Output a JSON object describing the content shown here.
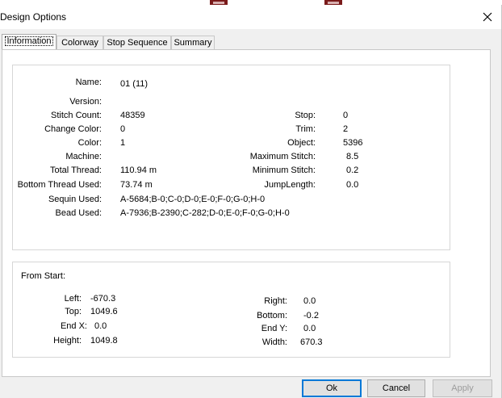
{
  "dialog": {
    "title": "Design Options"
  },
  "tabs": [
    "Information",
    "Colorway",
    "Stop Sequence",
    "Summary"
  ],
  "info": {
    "name_label": "Name:",
    "name_value": "01 (11)",
    "version_label": "Version:",
    "stitch_count_label": "Stitch Count:",
    "stitch_count_value": "48359",
    "change_color_label": "Change Color:",
    "change_color_value": "0",
    "color_label": "Color:",
    "color_value": "1",
    "machine_label": "Machine:",
    "total_thread_label": "Total Thread:",
    "total_thread_value": "110.94 m",
    "bottom_thread_label": "Bottom Thread Used:",
    "bottom_thread_value": "73.74 m",
    "sequin_label": "Sequin Used:",
    "sequin_value": "A-5684;B-0;C-0;D-0;E-0;F-0;G-0;H-0",
    "bead_label": "Bead Used:",
    "bead_value": "A-7936;B-2390;C-282;D-0;E-0;F-0;G-0;H-0",
    "stop_label": "Stop:",
    "stop_value": "0",
    "trim_label": "Trim:",
    "trim_value": "2",
    "object_label": "Object:",
    "object_value": "5396",
    "max_stitch_label": "Maximum Stitch:",
    "max_stitch_value": "8.5",
    "min_stitch_label": "Minimum Stitch:",
    "min_stitch_value": "0.2",
    "jump_label": "JumpLength:",
    "jump_value": "0.0"
  },
  "from_start": {
    "heading": "From Start:",
    "left_label": "Left:",
    "left_value": "-670.3",
    "top_label": "Top:",
    "top_value": "1049.6",
    "endx_label": "End X:",
    "endx_value": "0.0",
    "height_label": "Height:",
    "height_value": "1049.8",
    "right_label": "Right:",
    "right_value": "0.0",
    "bottom_label": "Bottom:",
    "bottom_value": "-0.2",
    "endy_label": "End Y:",
    "endy_value": "0.0",
    "width_label": "Width:",
    "width_value": "670.3"
  },
  "buttons": {
    "ok": "Ok",
    "cancel": "Cancel",
    "apply": "Apply"
  },
  "colors": {
    "focus_blue": "#0078d7",
    "dialog_bg": "#f0f0f0",
    "thumb_red": "#7a1a1a"
  }
}
